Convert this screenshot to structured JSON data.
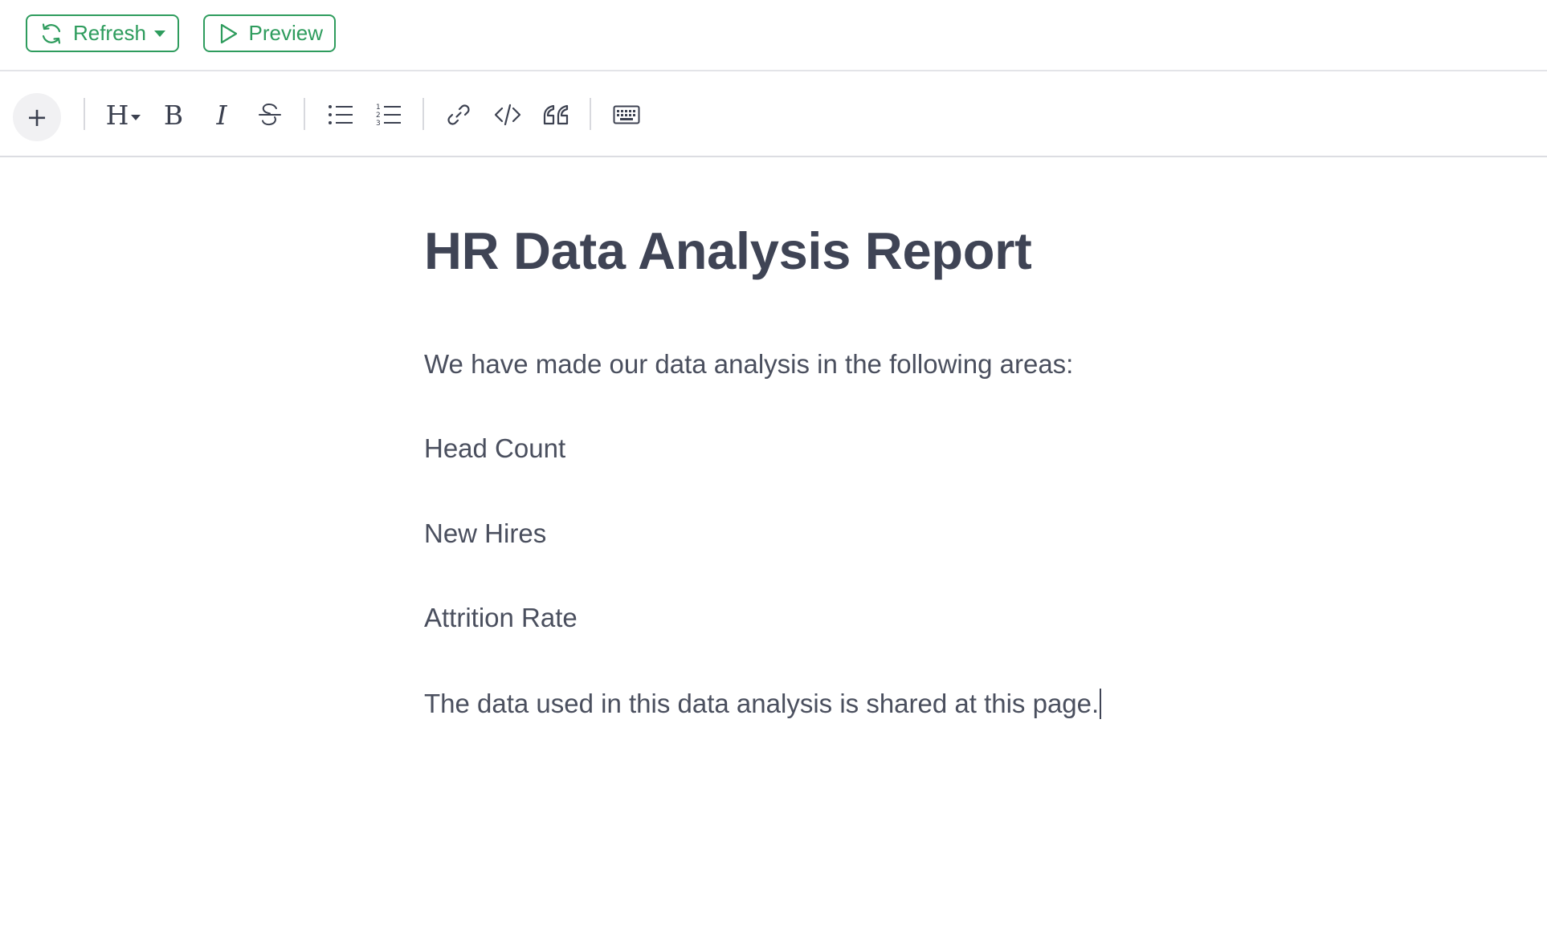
{
  "topbar": {
    "refresh_label": "Refresh",
    "preview_label": "Preview",
    "accent_color": "#2e9c5d"
  },
  "toolbar": {
    "add_label": "+",
    "heading_label": "H",
    "bold_label": "B",
    "italic_label": "I",
    "icons": [
      "plus-icon",
      "heading-icon",
      "bold-icon",
      "italic-icon",
      "strikethrough-icon",
      "bullet-list-icon",
      "numbered-list-icon",
      "link-icon",
      "code-icon",
      "quote-icon",
      "keyboard-icon"
    ]
  },
  "document": {
    "title": "HR Data Analysis Report",
    "intro": "We have made our data analysis in the following areas:",
    "areas": [
      "Head Count",
      "New Hires",
      "Attrition Rate"
    ],
    "closing": "The data used in this data analysis is shared at this page."
  }
}
